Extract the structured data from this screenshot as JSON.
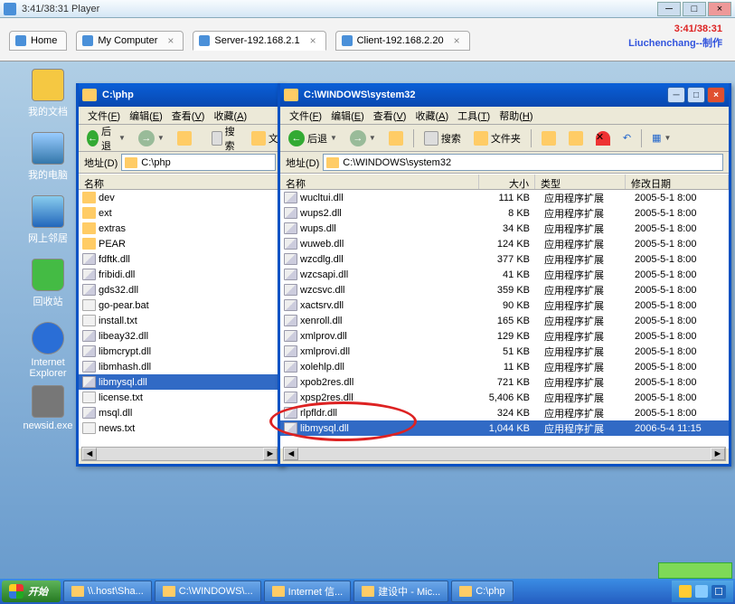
{
  "vm": {
    "title": "3:41/38:31 Player"
  },
  "brand": {
    "time": "3:41/38:31",
    "author": "Liuchenchang--制作"
  },
  "tabs": [
    {
      "label": "Home",
      "closable": false
    },
    {
      "label": "My Computer",
      "closable": true
    },
    {
      "label": "Server-192.168.2.1",
      "closable": true,
      "active": true
    },
    {
      "label": "Client-192.168.2.20",
      "closable": true
    }
  ],
  "desktop_icons": [
    {
      "label": "我的文档",
      "kind": "docs"
    },
    {
      "label": "我的电脑",
      "kind": "mycomp"
    },
    {
      "label": "网上邻居",
      "kind": "neigh"
    },
    {
      "label": "回收站",
      "kind": "recyc"
    },
    {
      "label": "Internet Explorer",
      "kind": "ie"
    },
    {
      "label": "newsid.exe",
      "kind": "exe"
    }
  ],
  "menu": [
    {
      "l": "文件",
      "k": "F"
    },
    {
      "l": "编辑",
      "k": "E"
    },
    {
      "l": "查看",
      "k": "V"
    },
    {
      "l": "收藏",
      "k": "A"
    },
    {
      "l": "工具",
      "k": "T"
    },
    {
      "l": "帮助",
      "k": "H"
    }
  ],
  "toolbar": {
    "back": "后退",
    "search": "搜索",
    "folders": "文件夹",
    "addr_label": "地址(D)"
  },
  "win_php": {
    "title": "C:\\php",
    "path": "C:\\php",
    "col_name": "名称",
    "items": [
      {
        "n": "dev",
        "t": "folder"
      },
      {
        "n": "ext",
        "t": "folder"
      },
      {
        "n": "extras",
        "t": "folder"
      },
      {
        "n": "PEAR",
        "t": "folder"
      },
      {
        "n": "fdftk.dll",
        "t": "dll"
      },
      {
        "n": "fribidi.dll",
        "t": "dll"
      },
      {
        "n": "gds32.dll",
        "t": "dll"
      },
      {
        "n": "go-pear.bat",
        "t": "file"
      },
      {
        "n": "install.txt",
        "t": "file"
      },
      {
        "n": "libeay32.dll",
        "t": "dll"
      },
      {
        "n": "libmcrypt.dll",
        "t": "dll"
      },
      {
        "n": "libmhash.dll",
        "t": "dll"
      },
      {
        "n": "libmysql.dll",
        "t": "dll",
        "sel": true
      },
      {
        "n": "license.txt",
        "t": "file"
      },
      {
        "n": "msql.dll",
        "t": "dll"
      },
      {
        "n": "news.txt",
        "t": "file"
      }
    ]
  },
  "win_sys": {
    "title": "C:\\WINDOWS\\system32",
    "path": "C:\\WINDOWS\\system32",
    "cols": {
      "name": "名称",
      "size": "大小",
      "type": "类型",
      "date": "修改日期"
    },
    "type_label": "应用程序扩展",
    "items": [
      {
        "n": "wucltui.dll",
        "s": "111 KB",
        "d": "2005-5-1 8:00"
      },
      {
        "n": "wups2.dll",
        "s": "8 KB",
        "d": "2005-5-1 8:00"
      },
      {
        "n": "wups.dll",
        "s": "34 KB",
        "d": "2005-5-1 8:00"
      },
      {
        "n": "wuweb.dll",
        "s": "124 KB",
        "d": "2005-5-1 8:00"
      },
      {
        "n": "wzcdlg.dll",
        "s": "377 KB",
        "d": "2005-5-1 8:00"
      },
      {
        "n": "wzcsapi.dll",
        "s": "41 KB",
        "d": "2005-5-1 8:00"
      },
      {
        "n": "wzcsvc.dll",
        "s": "359 KB",
        "d": "2005-5-1 8:00"
      },
      {
        "n": "xactsrv.dll",
        "s": "90 KB",
        "d": "2005-5-1 8:00"
      },
      {
        "n": "xenroll.dll",
        "s": "165 KB",
        "d": "2005-5-1 8:00"
      },
      {
        "n": "xmlprov.dll",
        "s": "129 KB",
        "d": "2005-5-1 8:00"
      },
      {
        "n": "xmlprovi.dll",
        "s": "51 KB",
        "d": "2005-5-1 8:00"
      },
      {
        "n": "xolehlp.dll",
        "s": "11 KB",
        "d": "2005-5-1 8:00"
      },
      {
        "n": "xpob2res.dll",
        "s": "721 KB",
        "d": "2005-5-1 8:00"
      },
      {
        "n": "xpsp2res.dll",
        "s": "5,406 KB",
        "d": "2005-5-1 8:00"
      },
      {
        "n": "rlpfldr.dll",
        "s": "324 KB",
        "d": "2005-5-1 8:00"
      },
      {
        "n": "libmysql.dll",
        "s": "1,044 KB",
        "d": "2006-5-4 11:15",
        "sel": true
      }
    ]
  },
  "taskbar": {
    "start": "开始",
    "buttons": [
      "\\\\.host\\Sha...",
      "C:\\WINDOWS\\...",
      "Internet 信...",
      "建设中 - Mic...",
      "C:\\php"
    ]
  }
}
